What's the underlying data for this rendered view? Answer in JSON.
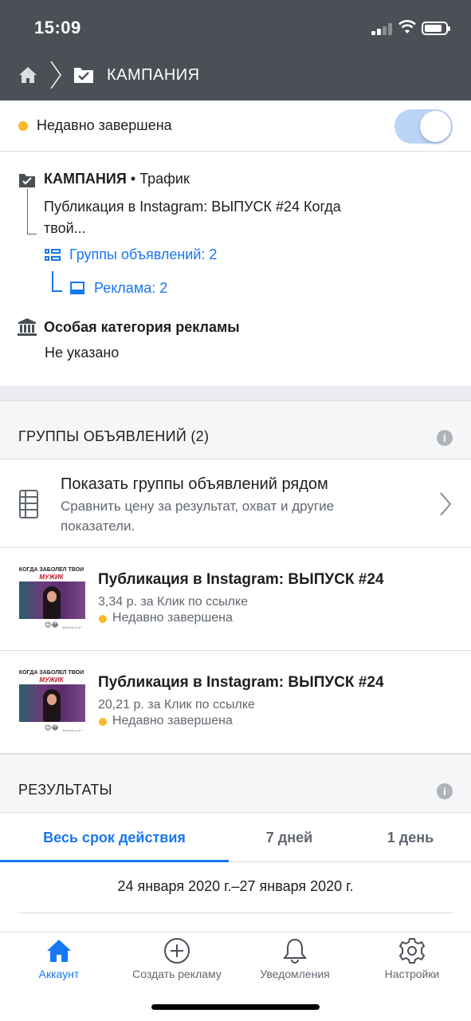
{
  "status_bar": {
    "time": "15:09"
  },
  "nav": {
    "title": "КАМПАНИЯ"
  },
  "campaign_status": {
    "label": "Недавно завершена",
    "dot_color": "#f7b928",
    "toggle_on": true
  },
  "structure": {
    "campaign_label": "КАМПАНИЯ",
    "objective": "• Трафик",
    "publication": "Публикация в Instagram: ВЫПУСК #24 Когда твой...",
    "ad_groups_link": "Группы объявлений: 2",
    "ads_link": "Реклама: 2"
  },
  "special_category": {
    "title": "Особая категория рекламы",
    "value": "Не указано"
  },
  "ad_groups_section": {
    "title": "ГРУППЫ ОБЪЯВЛЕНИЙ (2)",
    "compare": {
      "title": "Показать группы объявлений рядом",
      "subtitle": "Сравнить цену за результат, охват и другие показатели."
    },
    "items": [
      {
        "thumb_caption1": "КОГДА ЗАБОЛЕЛ ТВОЙ",
        "thumb_caption2": "МУЖИК",
        "thumb_emoji": "😉😂",
        "thumb_handle": "@kalusha_er7",
        "title": "Публикация в Instagram: ВЫПУСК #24",
        "cost": "3,34 р. за Клик по ссылке",
        "status": "Недавно завершена"
      },
      {
        "thumb_caption1": "КОГДА ЗАБОЛЕЛ ТВОЙ",
        "thumb_caption2": "МУЖИК",
        "thumb_emoji": "😉😂",
        "thumb_handle": "@kalusha_er7",
        "title": "Публикация в Instagram: ВЫПУСК #24",
        "cost": "20,21 р. за Клик по ссылке",
        "status": "Недавно завершена"
      }
    ]
  },
  "results_section": {
    "title": "РЕЗУЛЬТАТЫ",
    "tabs": [
      "Весь срок действия",
      "7 дней",
      "1 день"
    ],
    "active_tab": 0,
    "date_range": "24 января 2020 г.–27 января 2020 г."
  },
  "info_icon_glyph": "i",
  "tabbar": {
    "items": [
      {
        "label": "Аккаунт",
        "icon": "home-icon"
      },
      {
        "label": "Создать рекламу",
        "icon": "plus-circle-icon"
      },
      {
        "label": "Уведомления",
        "icon": "bell-icon"
      },
      {
        "label": "Настройки",
        "icon": "gear-icon"
      }
    ],
    "active": 0
  },
  "colors": {
    "accent": "#1877f2",
    "header_bg": "#4b4f56",
    "warning": "#f7b928"
  }
}
